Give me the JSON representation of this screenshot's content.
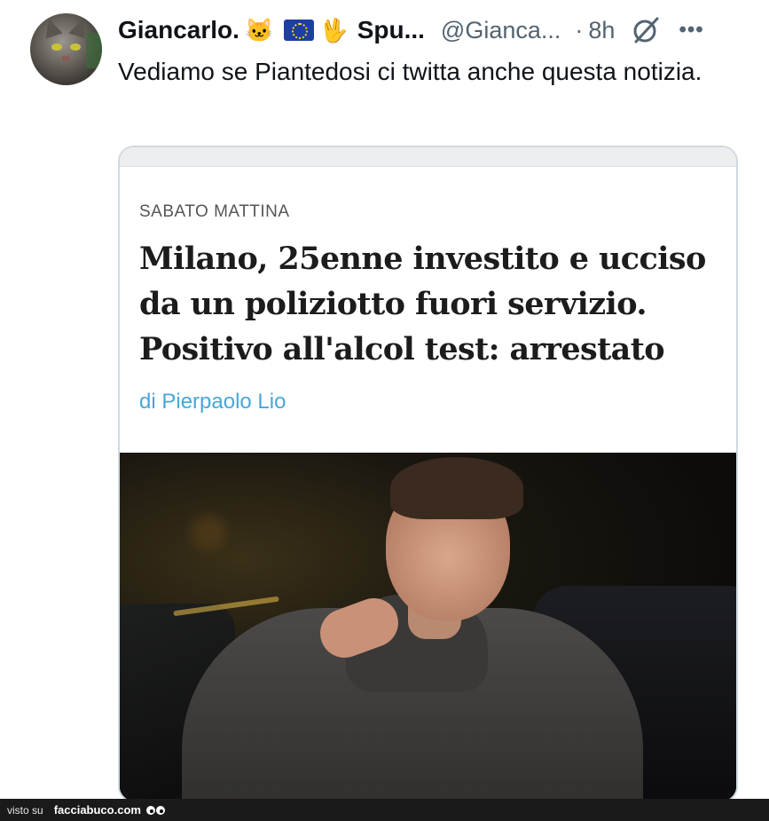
{
  "tweet": {
    "author_name": "Giancarlo.",
    "author_name_suffix": "Spu...",
    "handle": "@Gianca...",
    "separator": "·",
    "time": "8h",
    "text": "Vediamo se Piantedosi ci twitta anche questa notizia.",
    "emojis": [
      "cat-face",
      "eu-flag",
      "vulcan-salute"
    ]
  },
  "card": {
    "kicker": "SABATO MATTINA",
    "headline": "Milano, 25enne investito e ucciso da un poliziotto fuori servizio. Positivo all'alcol test: arrestato",
    "author": "di Pierpaolo Lio"
  },
  "footer": {
    "prefix": "visto su",
    "brand": "facciabuco.com"
  },
  "colors": {
    "text": "#0f1419",
    "muted": "#536471",
    "author_link": "#4aa6d6",
    "card_border": "#cfd9de"
  }
}
